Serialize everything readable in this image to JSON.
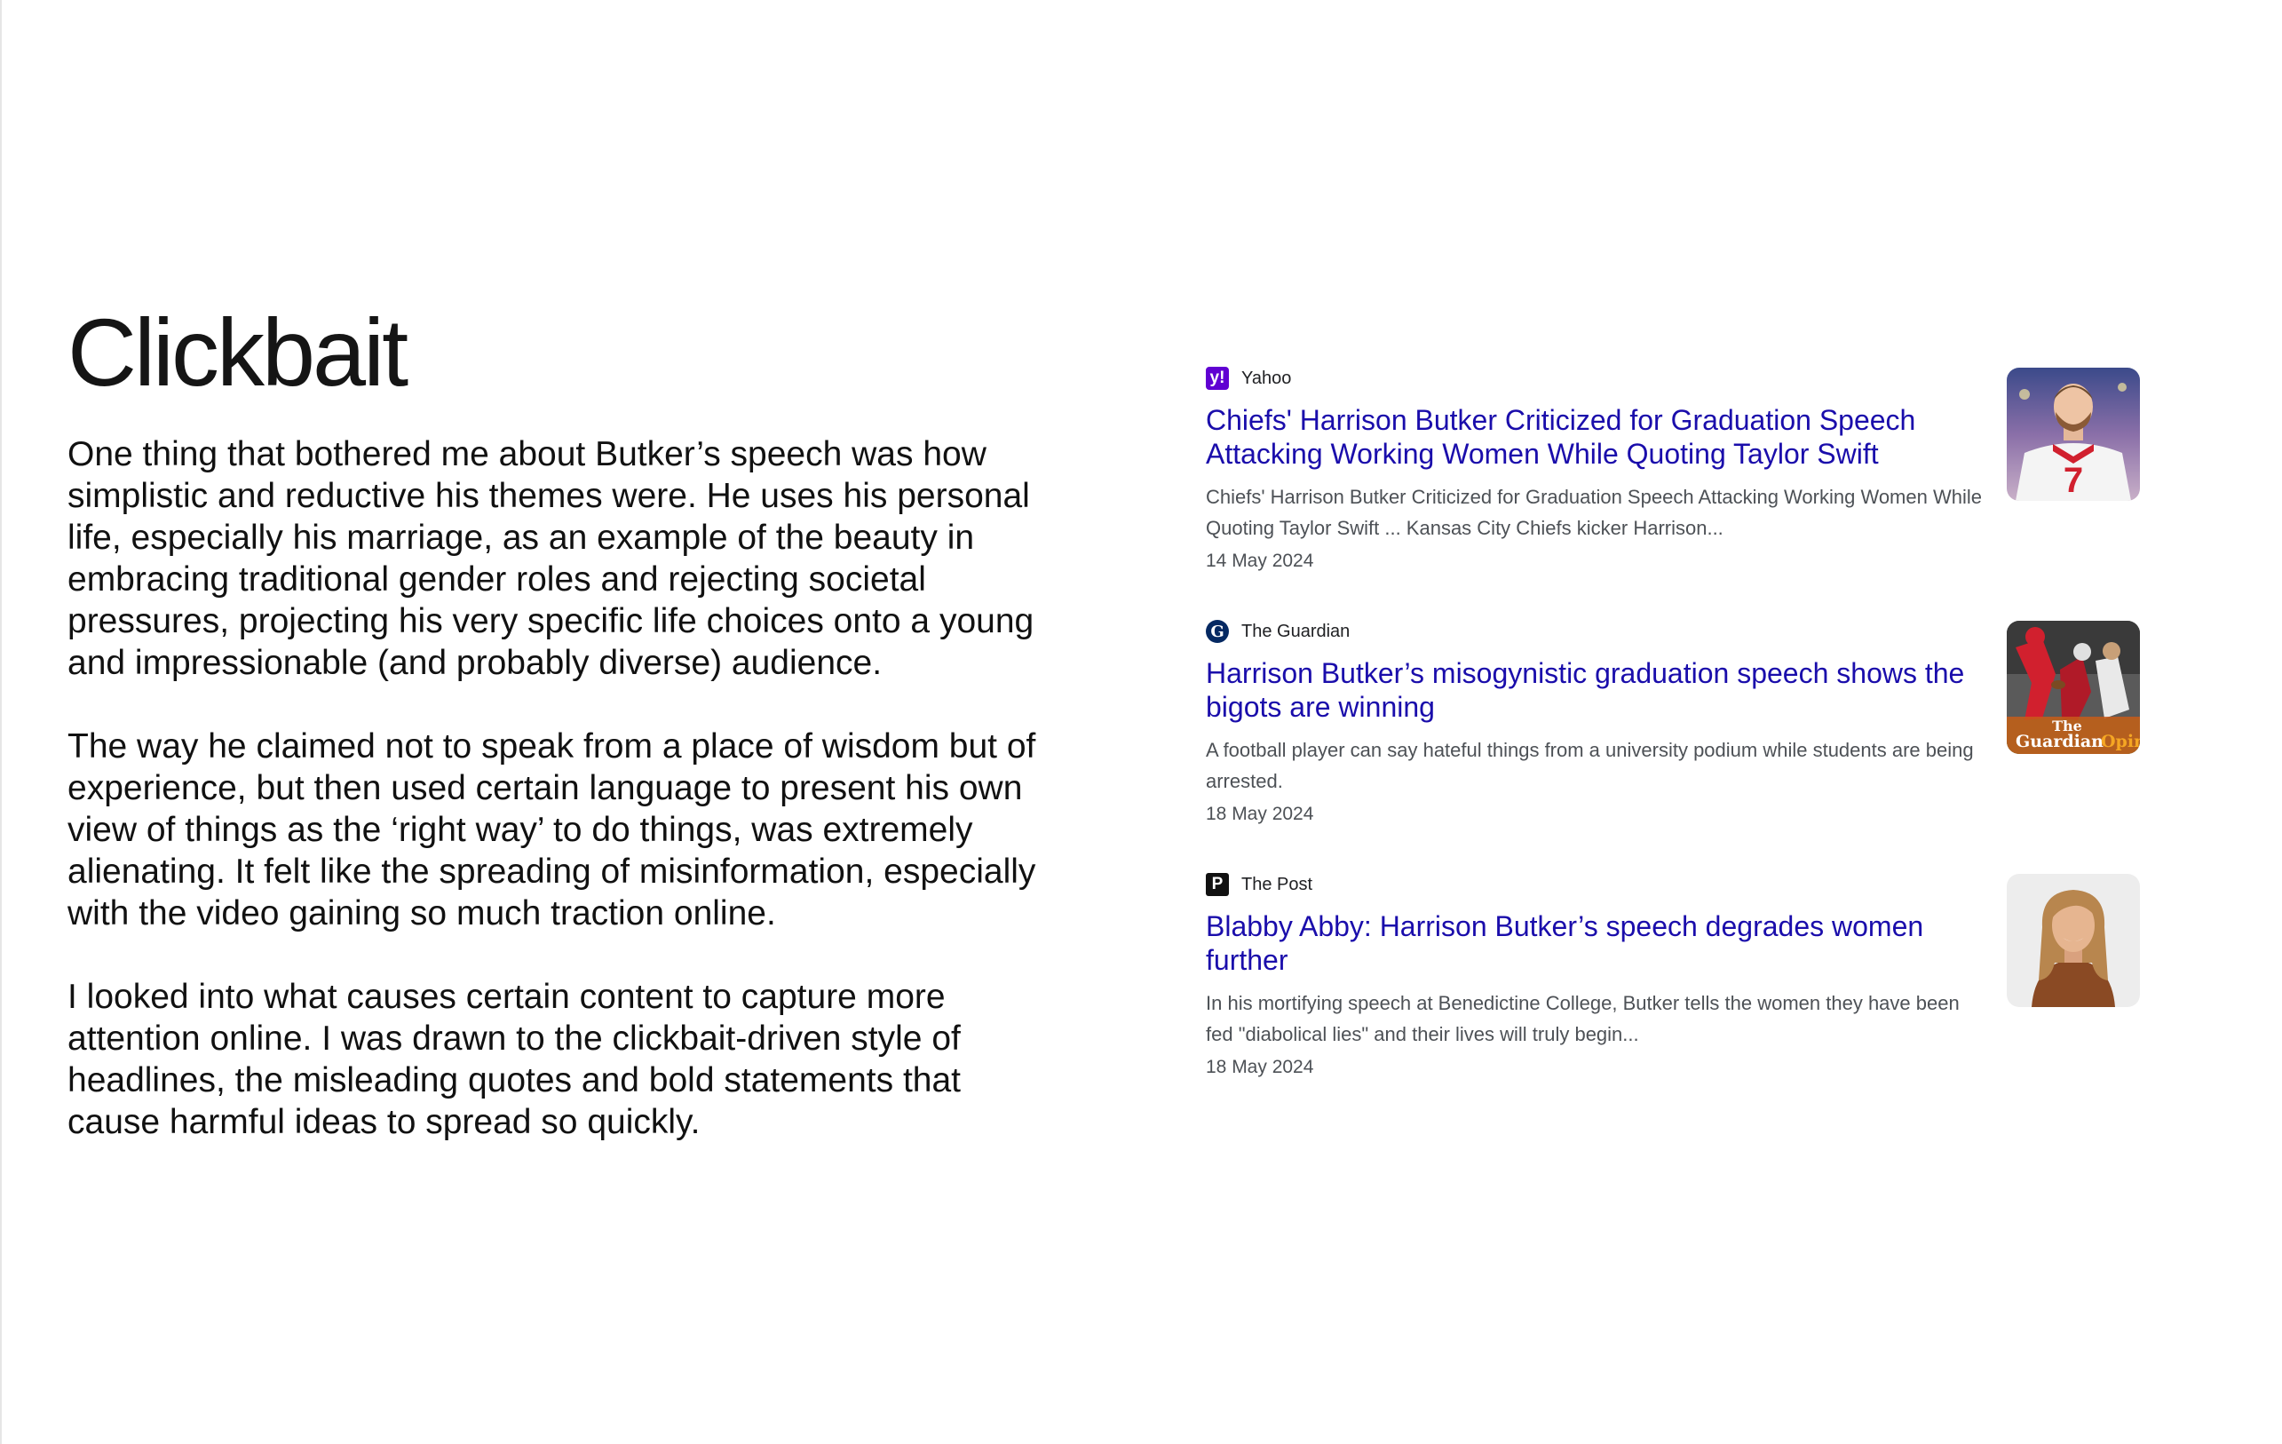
{
  "slide": {
    "title": "Clickbait",
    "paragraphs": [
      "One thing that bothered me about Butker’s speech was how simplistic and reductive his themes were. He uses his personal life, especially his marriage, as an example of the beauty in embracing traditional gender roles and rejecting societal pressures, projecting his very specific life choices onto a young and impressionable (and probably diverse) audience.",
      "The way he claimed not to speak from a place of wisdom but of experience, but then used certain language to present his own view of things as the ‘right way’ to do things, was extremely alienating. It felt like the spreading of misinformation, especially with the video gaining so much traction online.",
      "I looked into what causes certain content to capture more attention online. I was drawn to the clickbait-driven style of headlines, the misleading quotes and bold statements that cause harmful ideas to spread so quickly."
    ]
  },
  "results": [
    {
      "source": "Yahoo",
      "favicon_glyph": "y!",
      "favicon_icon": "yahoo-favicon-icon",
      "headline": "Chiefs' Harrison Butker Criticized for Graduation Speech Attacking Working Women While Quoting Taylor Swift",
      "snippet": "Chiefs' Harrison Butker Criticized for Graduation Speech Attacking Working Women While Quoting Taylor Swift ... Kansas City Chiefs kicker Harrison...",
      "date": "14 May 2024",
      "thumbnail": "football-player-photo"
    },
    {
      "source": "The Guardian",
      "favicon_glyph": "G",
      "favicon_icon": "guardian-favicon-icon",
      "headline": "Harrison Butker’s misogynistic graduation speech shows the bigots are winning",
      "snippet": "A football player can say hateful things from a university podium while students are being arrested.",
      "date": "18 May 2024",
      "thumbnail": "football-kick-photo",
      "thumbnail_caption_1": "The",
      "thumbnail_caption_2": "Guardian",
      "thumbnail_caption_3": "Opin"
    },
    {
      "source": "The Post",
      "favicon_glyph": "P",
      "favicon_icon": "post-favicon-icon",
      "headline": "Blabby Abby: Harrison Butker’s speech degrades women further",
      "snippet": "In his mortifying speech at Benedictine College, Butker tells the women they have been fed \"diabolical lies\" and their lives will truly begin...",
      "date": "18 May 2024",
      "thumbnail": "woman-portrait-photo"
    }
  ],
  "colors": {
    "link": "#1a0dab",
    "snippet": "#4d5156",
    "yahoo": "#6001d2",
    "guardian": "#052962",
    "chiefs_red": "#d1202e",
    "guardian_orange": "#f5a623"
  }
}
